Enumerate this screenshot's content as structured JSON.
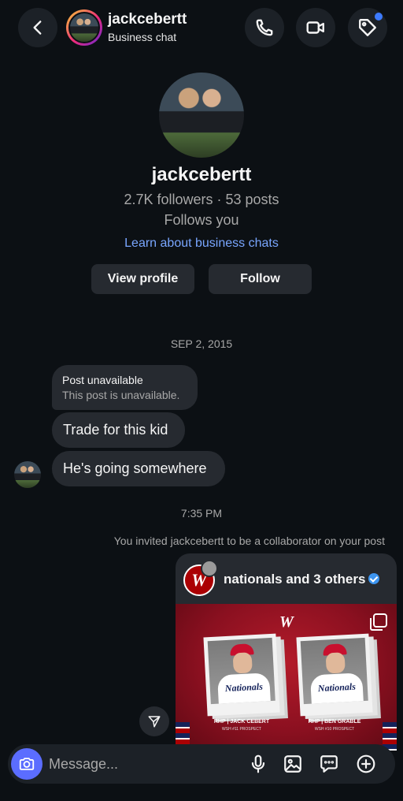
{
  "header": {
    "username": "jackcebertt",
    "subtitle": "Business chat",
    "icons": [
      "back-arrow-icon",
      "phone-icon",
      "video-camera-icon",
      "tag-icon"
    ],
    "tag_dot_color": "#3d7bff"
  },
  "profile": {
    "name": "jackcebertt",
    "stats": "2.7K followers · 53 posts",
    "follows_you": "Follows you",
    "learn_link": "Learn about business chats",
    "view_profile_label": "View profile",
    "follow_label": "Follow"
  },
  "conversation": {
    "date_label": "SEP 2, 2015",
    "post_unavailable_title": "Post unavailable",
    "post_unavailable_sub": "This post is unavailable.",
    "messages": [
      "Trade for this kid",
      "He's going somewhere"
    ],
    "time_label": "7:35 PM",
    "system_note": "You invited jackcebertt to be a collaborator on your post"
  },
  "shared_post": {
    "title": "nationals and 3 others",
    "verified": true,
    "logo_letter": "W",
    "players": [
      {
        "jersey": "Nationals",
        "caption": "RHP | JACK CEBERT",
        "sub": "WSH #11 PROSPECT"
      },
      {
        "jersey": "Nationals",
        "caption": "RHP | BEN GRABLE",
        "sub": "WSH #10 PROSPECT"
      }
    ]
  },
  "composer": {
    "placeholder": "Message...",
    "icons": [
      "camera-icon",
      "microphone-icon",
      "gallery-icon",
      "sticker-icon",
      "plus-icon"
    ],
    "camera_color": "#5b6dff"
  },
  "colors": {
    "background": "#0c1014",
    "bubble": "#262a30",
    "link": "#79a6ff",
    "nationals_red": "#ab0003"
  }
}
